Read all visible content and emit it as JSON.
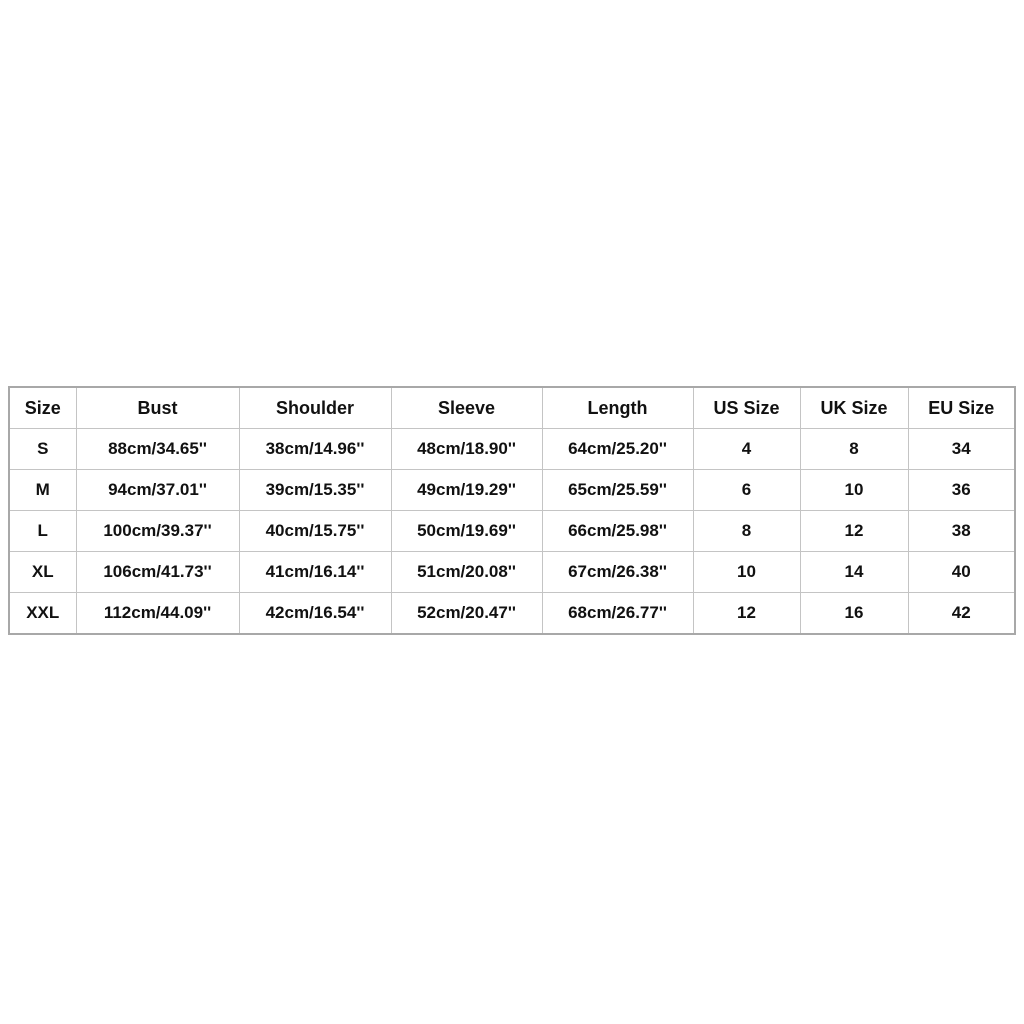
{
  "size_chart": {
    "headers": [
      "Size",
      "Bust",
      "Shoulder",
      "Sleeve",
      "Length",
      "US Size",
      "UK Size",
      "EU Size"
    ],
    "rows": [
      [
        "S",
        "88cm/34.65''",
        "38cm/14.96''",
        "48cm/18.90''",
        "64cm/25.20''",
        "4",
        "8",
        "34"
      ],
      [
        "M",
        "94cm/37.01''",
        "39cm/15.35''",
        "49cm/19.29''",
        "65cm/25.59''",
        "6",
        "10",
        "36"
      ],
      [
        "L",
        "100cm/39.37''",
        "40cm/15.75''",
        "50cm/19.69''",
        "66cm/25.98''",
        "8",
        "12",
        "38"
      ],
      [
        "XL",
        "106cm/41.73''",
        "41cm/16.14''",
        "51cm/20.08''",
        "67cm/26.38''",
        "10",
        "14",
        "40"
      ],
      [
        "XXL",
        "112cm/44.09''",
        "42cm/16.54''",
        "52cm/20.47''",
        "68cm/26.77''",
        "12",
        "16",
        "42"
      ]
    ]
  }
}
